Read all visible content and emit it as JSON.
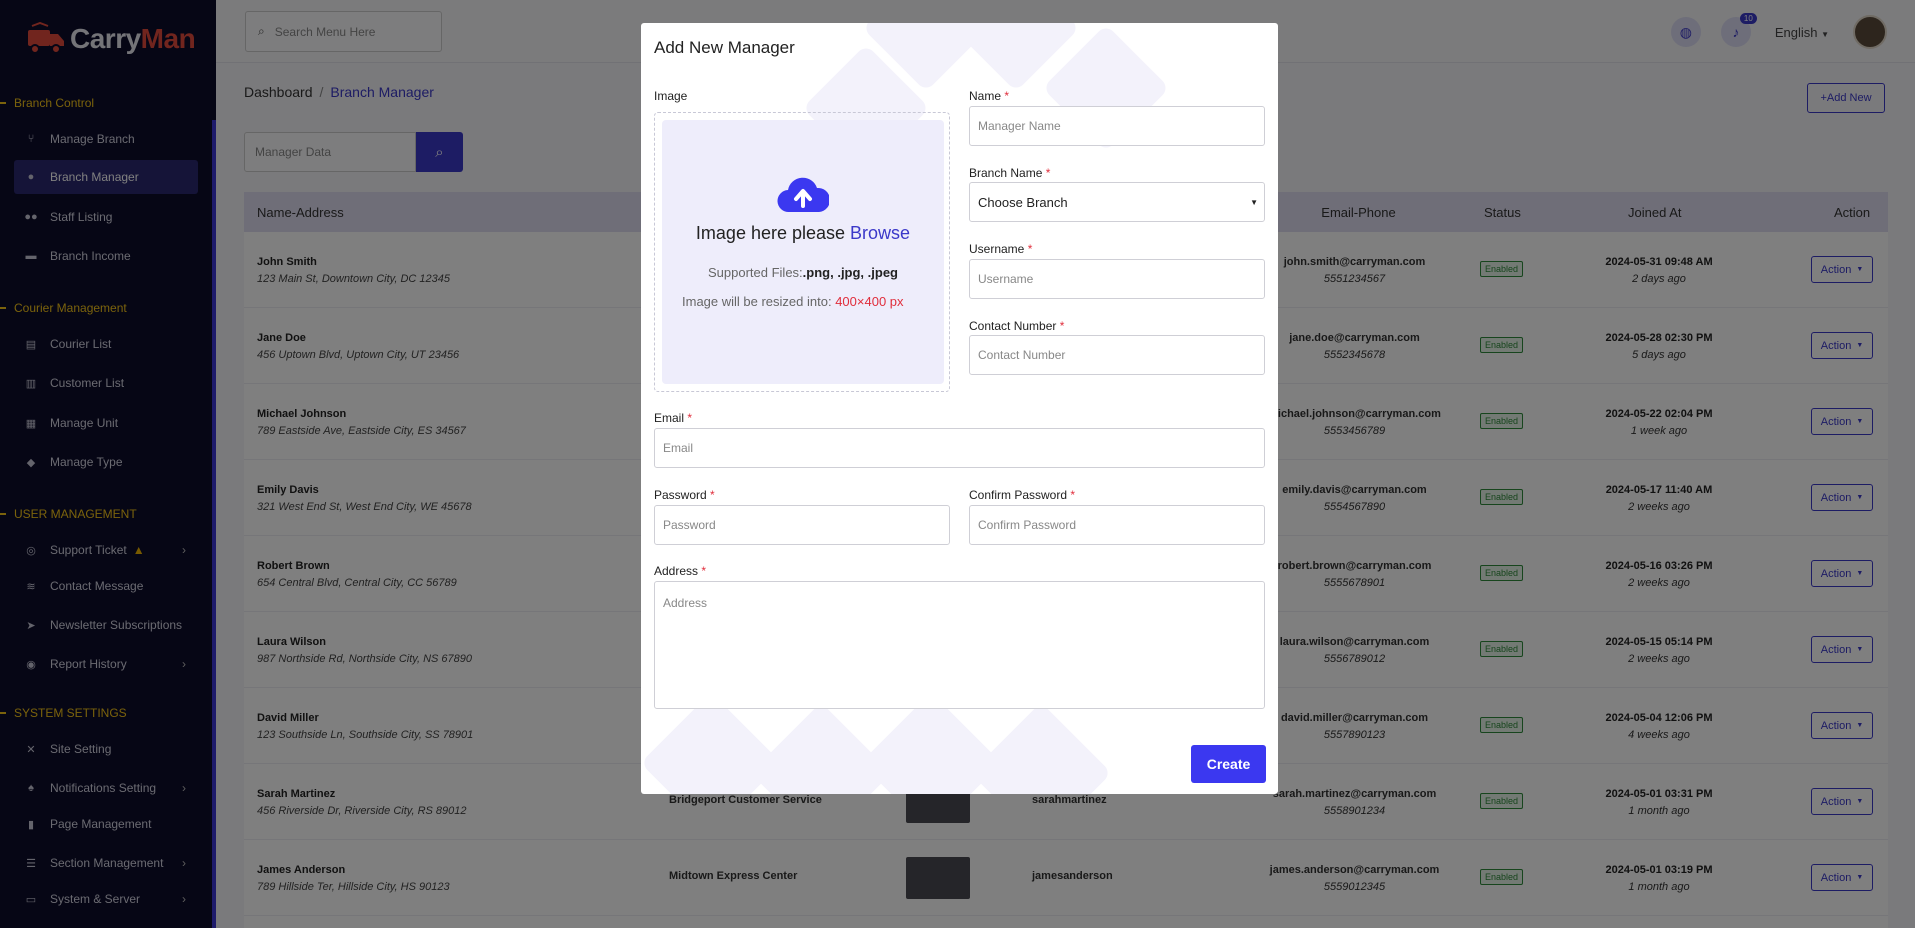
{
  "app": {
    "logo_part1": "Carry",
    "logo_part2": "Man"
  },
  "sidebar": {
    "sections": [
      {
        "title": "Branch Control"
      },
      {
        "title": "Courier Management"
      },
      {
        "title": "USER MANAGEMENT"
      },
      {
        "title": "SYSTEM SETTINGS"
      }
    ],
    "items": [
      {
        "label": "Manage Branch"
      },
      {
        "label": "Branch Manager"
      },
      {
        "label": "Staff Listing"
      },
      {
        "label": "Branch Income"
      },
      {
        "label": "Courier List"
      },
      {
        "label": "Customer List"
      },
      {
        "label": "Manage Unit"
      },
      {
        "label": "Manage Type"
      },
      {
        "label": "Support Ticket"
      },
      {
        "label": "Contact Message"
      },
      {
        "label": "Newsletter Subscriptions"
      },
      {
        "label": "Report History"
      },
      {
        "label": "Site Setting"
      },
      {
        "label": "Notifications Setting"
      },
      {
        "label": "Page Management"
      },
      {
        "label": "Section Management"
      },
      {
        "label": "System & Server"
      }
    ]
  },
  "topbar": {
    "search_placeholder": "Search Menu Here",
    "notification_count": "10",
    "language": "English"
  },
  "breadcrumb": {
    "home": "Dashboard",
    "current": "Branch Manager"
  },
  "add_new_label": "+Add New",
  "filter": {
    "placeholder": "Manager Data"
  },
  "table": {
    "headers": {
      "name_address": "Name-Address",
      "email_phone": "Email-Phone",
      "status": "Status",
      "joined": "Joined At",
      "action": "Action"
    },
    "rows": [
      {
        "name": "John Smith",
        "address": "123 Main St, Downtown City, DC 12345",
        "branch": "",
        "username": "",
        "email": "john.smith@carryman.com",
        "phone": "5551234567",
        "status": "Enabled",
        "date": "2024-05-31 09:48 AM",
        "ago": "2 days ago",
        "action": "Action"
      },
      {
        "name": "Jane Doe",
        "address": "456 Uptown Blvd, Uptown City, UT 23456",
        "branch": "",
        "username": "",
        "email": "jane.doe@carryman.com",
        "phone": "5552345678",
        "status": "Enabled",
        "date": "2024-05-28 02:30 PM",
        "ago": "5 days ago",
        "action": "Action"
      },
      {
        "name": "Michael Johnson",
        "address": "789 Eastside Ave, Eastside City, ES 34567",
        "branch": "",
        "username": "",
        "email": "michael.johnson@carryman.com",
        "phone": "5553456789",
        "status": "Enabled",
        "date": "2024-05-22 02:04 PM",
        "ago": "1 week ago",
        "action": "Action"
      },
      {
        "name": "Emily Davis",
        "address": "321 West End St, West End City, WE 45678",
        "branch": "",
        "username": "",
        "email": "emily.davis@carryman.com",
        "phone": "5554567890",
        "status": "Enabled",
        "date": "2024-05-17 11:40 AM",
        "ago": "2 weeks ago",
        "action": "Action"
      },
      {
        "name": "Robert Brown",
        "address": "654 Central Blvd, Central City, CC 56789",
        "branch": "",
        "username": "",
        "email": "robert.brown@carryman.com",
        "phone": "5555678901",
        "status": "Enabled",
        "date": "2024-05-16 03:26 PM",
        "ago": "2 weeks ago",
        "action": "Action"
      },
      {
        "name": "Laura Wilson",
        "address": "987 Northside Rd, Northside City, NS 67890",
        "branch": "",
        "username": "",
        "email": "laura.wilson@carryman.com",
        "phone": "5556789012",
        "status": "Enabled",
        "date": "2024-05-15 05:14 PM",
        "ago": "2 weeks ago",
        "action": "Action"
      },
      {
        "name": "David Miller",
        "address": "123 Southside Ln, Southside City, SS 78901",
        "branch": "",
        "username": "",
        "email": "david.miller@carryman.com",
        "phone": "5557890123",
        "status": "Enabled",
        "date": "2024-05-04 12:06 PM",
        "ago": "4 weeks ago",
        "action": "Action"
      },
      {
        "name": "Sarah Martinez",
        "address": "456 Riverside Dr, Riverside City, RS 89012",
        "branch": "Bridgeport Customer Service",
        "username": "sarahmartinez",
        "email": "sarah.martinez@carryman.com",
        "phone": "5558901234",
        "status": "Enabled",
        "date": "2024-05-01 03:31 PM",
        "ago": "1 month ago",
        "action": "Action"
      },
      {
        "name": "James Anderson",
        "address": "789 Hillside Ter, Hillside City, HS 90123",
        "branch": "Midtown Express Center",
        "username": "jamesanderson",
        "email": "james.anderson@carryman.com",
        "phone": "5559012345",
        "status": "Enabled",
        "date": "2024-05-01 03:19 PM",
        "ago": "1 month ago",
        "action": "Action"
      }
    ]
  },
  "modal": {
    "title": "Add New Manager",
    "image_label": "Image",
    "upload_text": "Image here please",
    "upload_browse": "Browse",
    "supported_label": "Supported Files:",
    "supported_types": ".png, .jpg, .jpeg",
    "resize_text": "Image will be resized into:",
    "resize_size": "400×400 px",
    "name_label": "Name",
    "name_placeholder": "Manager Name",
    "branch_label": "Branch Name",
    "branch_value": "Choose Branch",
    "username_label": "Username",
    "username_placeholder": "Username",
    "contact_label": "Contact Number",
    "contact_placeholder": "Contact Number",
    "email_label": "Email",
    "email_placeholder": "Email",
    "password_label": "Password",
    "password_placeholder": "Password",
    "confirm_label": "Confirm Password",
    "confirm_placeholder": "Confirm Password",
    "address_label": "Address",
    "address_placeholder": "Address",
    "required_mark": "*",
    "create_label": "Create"
  },
  "colors": {
    "accent": "#3b38c9",
    "sidebar_bg": "#0d0c2b",
    "section_title": "#f5c518",
    "required": "#e02e3c"
  }
}
